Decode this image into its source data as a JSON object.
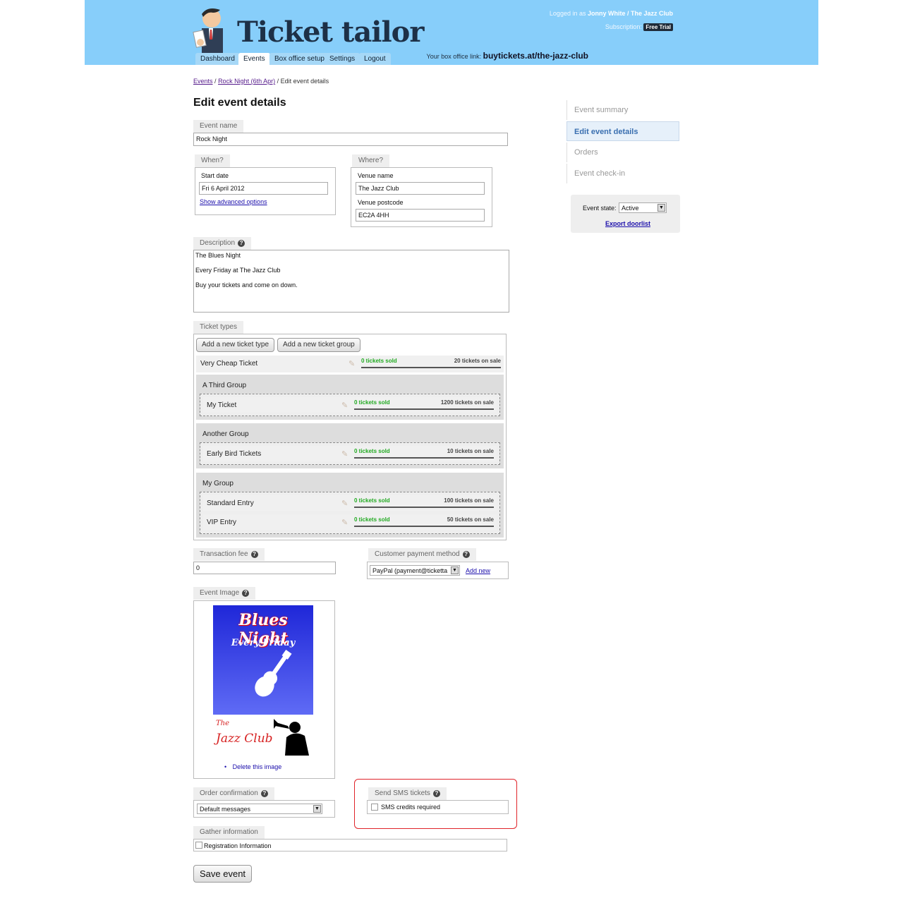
{
  "header": {
    "app_name": "Ticket tailor",
    "logged_in_prefix": "Logged in as",
    "user": "Jonny White / The Jazz Club",
    "subscription_label": "Subscription:",
    "subscription_value": "Free Trial",
    "box_office_label": "Your box office link:",
    "box_office_link": "buytickets.at/the-jazz-club",
    "nav": [
      "Dashboard",
      "Events",
      "Box office setup",
      "Settings",
      "Logout"
    ]
  },
  "breadcrumb": {
    "events": "Events",
    "sep1": "/",
    "event": "Rock Night (6th Apr)",
    "sep2": "/",
    "current": "Edit event details"
  },
  "page_title": "Edit event details",
  "event_name": {
    "label": "Event name",
    "value": "Rock Night"
  },
  "when": {
    "label": "When?",
    "start_date_label": "Start date",
    "start_date_value": "Fri 6 April 2012",
    "advanced_link": "Show advanced options"
  },
  "where": {
    "label": "Where?",
    "venue_name_label": "Venue name",
    "venue_name_value": "The Jazz Club",
    "venue_postcode_label": "Venue postcode",
    "venue_postcode_value": "EC2A 4HH"
  },
  "description": {
    "label": "Description",
    "line1": "The Blues Night",
    "line2": "Every Friday at The Jazz Club",
    "line3": "Buy your tickets and come on down."
  },
  "ticket_types": {
    "label": "Ticket types",
    "add_type_button": "Add a new ticket type",
    "add_group_button": "Add a new ticket group",
    "single": {
      "name": "Very Cheap Ticket",
      "sold": "0 tickets sold",
      "on_sale": "20 tickets on sale"
    },
    "groups": [
      {
        "name": "A Third Group",
        "tickets": [
          {
            "name": "My Ticket",
            "sold": "0 tickets sold",
            "on_sale": "1200 tickets on sale"
          }
        ]
      },
      {
        "name": "Another Group",
        "tickets": [
          {
            "name": "Early Bird Tickets",
            "sold": "0 tickets sold",
            "on_sale": "10 tickets on sale"
          }
        ]
      },
      {
        "name": "My Group",
        "tickets": [
          {
            "name": "Standard Entry",
            "sold": "0 tickets sold",
            "on_sale": "100 tickets on sale"
          },
          {
            "name": "VIP Entry",
            "sold": "0 tickets sold",
            "on_sale": "50 tickets on sale"
          }
        ]
      }
    ]
  },
  "transaction_fee": {
    "label": "Transaction fee",
    "value": "0"
  },
  "payment_method": {
    "label": "Customer payment method",
    "value": "PayPal (payment@ticketta",
    "add_new": "Add new"
  },
  "event_image": {
    "label": "Event Image",
    "poster_title": "Blues Night",
    "poster_sub": "Every Friday",
    "club_the": "The",
    "club_name": "Jazz Club",
    "delete_link": "Delete this image"
  },
  "order_confirmation": {
    "label": "Order confirmation",
    "value": "Default messages"
  },
  "sms": {
    "label": "Send SMS tickets",
    "checkbox_label": "SMS credits required"
  },
  "gather_info": {
    "label": "Gather information",
    "checkbox_label": "Registration Information"
  },
  "save_button": "Save event",
  "sidebar": {
    "items": [
      "Event summary",
      "Edit event details",
      "Orders",
      "Event check-in"
    ],
    "event_state_label": "Event state:",
    "event_state_value": "Active",
    "export_link": "Export doorlist"
  },
  "colors": {
    "header_bg": "#87cefa",
    "sold_green": "#22aa22",
    "highlight_red": "#e0242a",
    "poster_blue": "#2b35e8"
  }
}
